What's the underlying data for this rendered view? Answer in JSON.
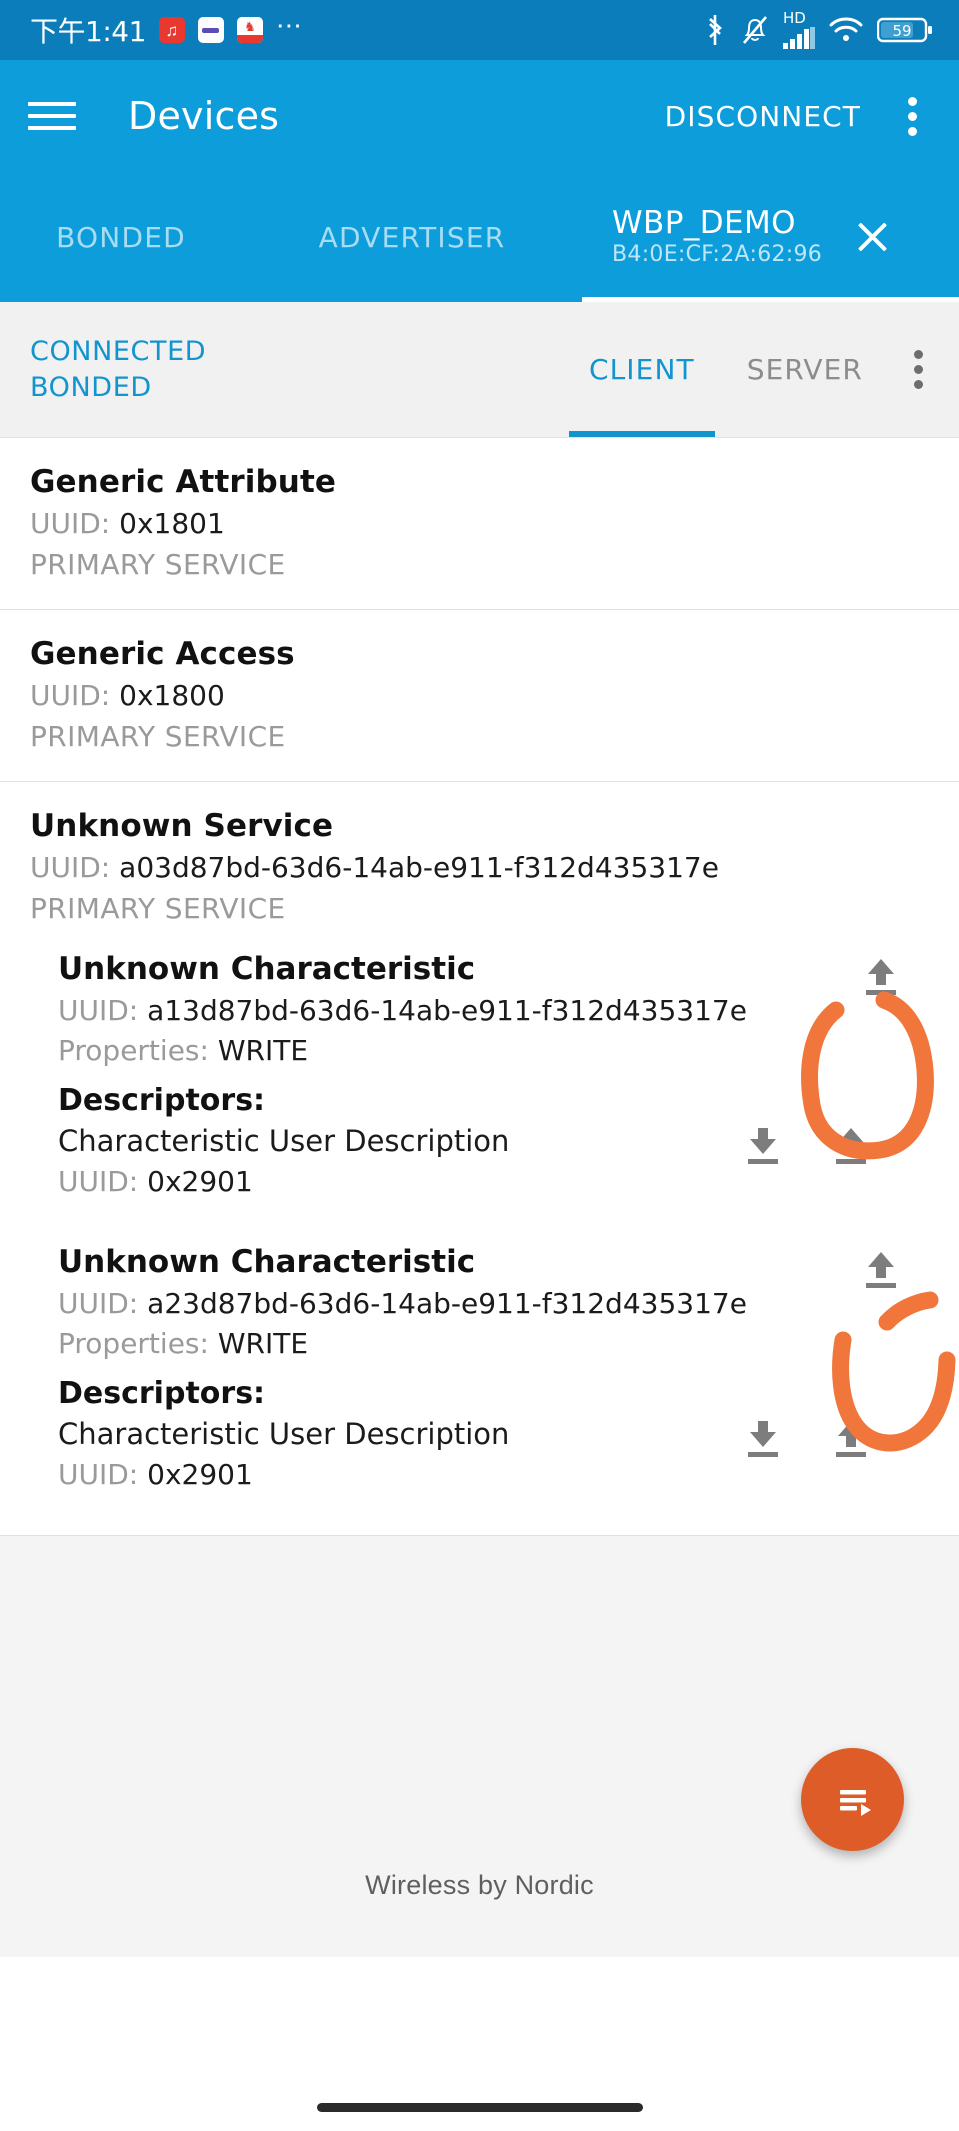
{
  "status_bar": {
    "time": "下午1:41",
    "notification_icons": [
      "music-note-icon",
      "purple-bar-icon",
      "app-badge-icon",
      "more-dots-icon"
    ],
    "right_icons": [
      "bluetooth-icon",
      "bell-muted-icon",
      "hd-icon",
      "signal-bars-icon",
      "wifi-icon",
      "battery-icon"
    ],
    "battery_level": "59",
    "hd_label": "HD"
  },
  "app_bar": {
    "menu_icon": "hamburger-menu-icon",
    "title": "Devices",
    "disconnect_label": "DISCONNECT",
    "overflow_icon": "kebab-menu-icon"
  },
  "tabs": [
    {
      "label": "BONDED",
      "active": false
    },
    {
      "label": "ADVERTISER",
      "active": false
    },
    {
      "label": "WBP_DEMO",
      "subtitle": "B4:0E:CF:2A:62:96",
      "active": true,
      "close_icon": "close-x-icon"
    }
  ],
  "connection": {
    "state": "CONNECTED",
    "bond_state": "BONDED",
    "client_tab": "CLIENT",
    "server_tab": "SERVER",
    "overflow_icon": "kebab-menu-icon"
  },
  "services": [
    {
      "name": "Generic Attribute",
      "uuid_label": "UUID:",
      "uuid": "0x1801",
      "kind": "PRIMARY SERVICE",
      "characteristics": []
    },
    {
      "name": "Generic Access",
      "uuid_label": "UUID:",
      "uuid": "0x1800",
      "kind": "PRIMARY SERVICE",
      "characteristics": []
    },
    {
      "name": "Unknown Service",
      "uuid_label": "UUID:",
      "uuid": "a03d87bd-63d6-14ab-e911-f312d435317e",
      "kind": "PRIMARY SERVICE",
      "characteristics": [
        {
          "name": "Unknown Characteristic",
          "uuid_label": "UUID:",
          "uuid": "a13d87bd-63d6-14ab-e911-f312d435317e",
          "properties_label": "Properties:",
          "properties": "WRITE",
          "descriptors_label": "Descriptors:",
          "write_icon": "upload-write-icon",
          "descriptor": {
            "name": "Characteristic User Description",
            "uuid_label": "UUID:",
            "uuid": "0x2901",
            "read_icon": "download-read-icon",
            "write_icon": "upload-write-icon"
          }
        },
        {
          "name": "Unknown Characteristic",
          "uuid_label": "UUID:",
          "uuid": "a23d87bd-63d6-14ab-e911-f312d435317e",
          "properties_label": "Properties:",
          "properties": "WRITE",
          "descriptors_label": "Descriptors:",
          "write_icon": "upload-write-icon",
          "descriptor": {
            "name": "Characteristic User Description",
            "uuid_label": "UUID:",
            "uuid": "0x2901",
            "read_icon": "download-read-icon",
            "write_icon": "upload-write-icon"
          }
        }
      ]
    }
  ],
  "fab": {
    "icon": "playlist-play-icon"
  },
  "footer": {
    "text": "Wireless by Nordic"
  },
  "annotations": [
    {
      "shape": "hand-drawn-circle",
      "target": "first-characteristic-write-icon"
    },
    {
      "shape": "hand-drawn-u-curve",
      "target": "second-characteristic-write-icon"
    }
  ],
  "colors": {
    "status_bar": "#0b7dba",
    "app_bar": "#0d9ddb",
    "accent_blue": "#1294cf",
    "fab_orange": "#dd5c27",
    "annotation_orange": "#f0763c",
    "icon_gray": "#7d7d7d"
  }
}
